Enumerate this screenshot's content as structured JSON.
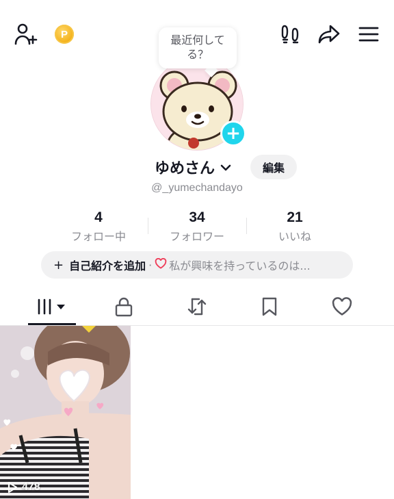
{
  "header": {
    "add_friend_icon": "person-plus-icon",
    "coin_label": "P",
    "footprint_icon": "footprints-icon",
    "share_icon": "share-arrow-icon",
    "menu_icon": "hamburger-menu-icon"
  },
  "bubble": {
    "text": "最近何してる？"
  },
  "profile": {
    "username": "ゆめさん",
    "handle": "@_yumechandayo",
    "edit_label": "編集"
  },
  "stats": [
    {
      "value": "4",
      "label": "フォロー中"
    },
    {
      "value": "34",
      "label": "フォロワー"
    },
    {
      "value": "21",
      "label": "いいね"
    }
  ],
  "bio": {
    "plus": "+",
    "add_label": "自己紹介を追加",
    "separator": "·",
    "interest_text": "私が興味を持っているのは..."
  },
  "tabs": [
    {
      "name": "videos",
      "icon": "grid-icon"
    },
    {
      "name": "private",
      "icon": "lock-icon"
    },
    {
      "name": "reposts",
      "icon": "repost-icon"
    },
    {
      "name": "favorites",
      "icon": "bookmark-icon"
    },
    {
      "name": "liked",
      "icon": "heart-icon"
    }
  ],
  "videos": [
    {
      "views": "478"
    }
  ],
  "colors": {
    "accent_cyan": "#20d5ec",
    "heart_red": "#ef3e5a",
    "coin_gold": "#f4b21c",
    "text_primary": "#161823",
    "text_secondary": "#8a8b91"
  }
}
